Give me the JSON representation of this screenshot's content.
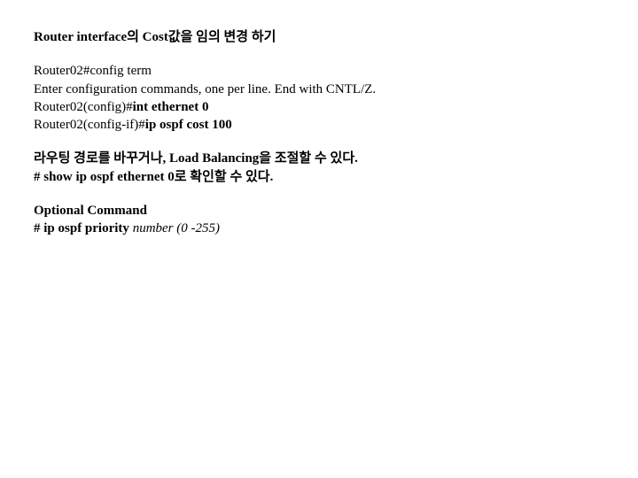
{
  "title": "Router interface의 Cost값을 임의 변경 하기",
  "config": {
    "line1": "Router02#config term",
    "line2": "Enter configuration commands, one per line.  End with CNTL/Z.",
    "line3_prefix": "Router02(config)#",
    "line3_cmd": "int ethernet 0",
    "line4_prefix": "Router02(config-if)#",
    "line4_cmd": "ip ospf cost 100"
  },
  "note": {
    "line1": "라우팅 경로를 바꾸거나, Load Balancing을 조절할 수 있다.",
    "line2": "# show ip ospf ethernet 0로 확인할 수 있다."
  },
  "optional": {
    "heading": "Optional Command",
    "cmd_prefix": "# ip ospf priority ",
    "cmd_arg": "number (0 -255)"
  }
}
